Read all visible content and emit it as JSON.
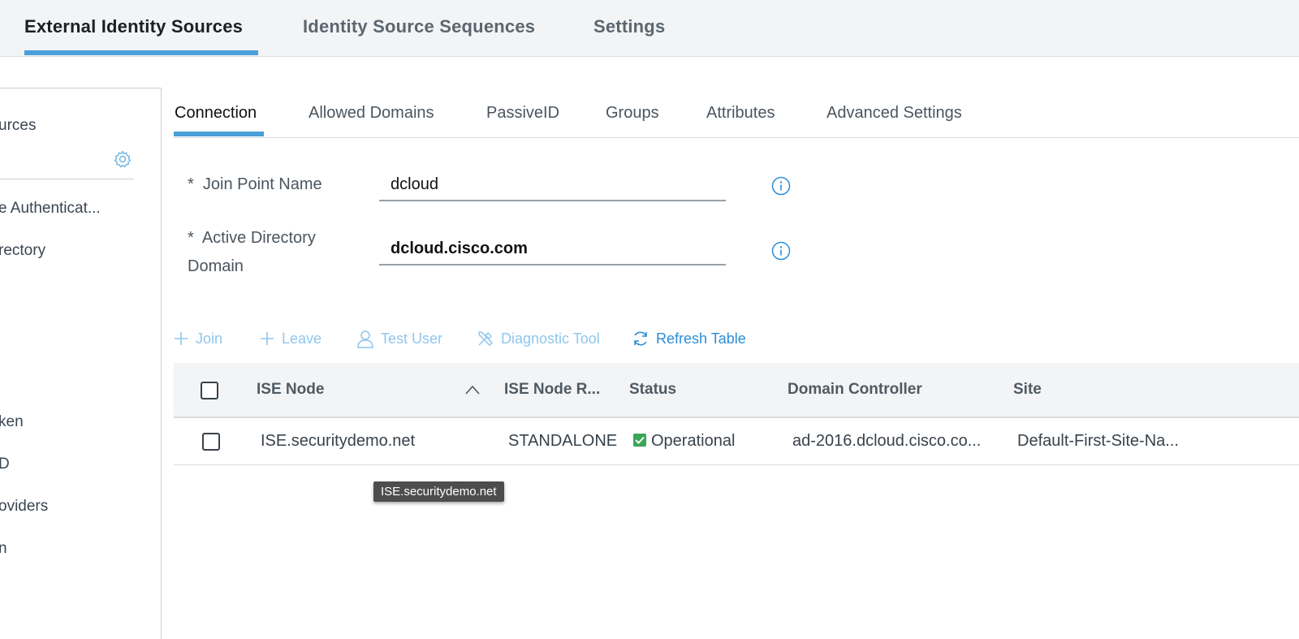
{
  "top_tabs": [
    {
      "label": "External Identity Sources",
      "active": true
    },
    {
      "label": "Identity Source Sequences",
      "active": false
    },
    {
      "label": "Settings",
      "active": false
    }
  ],
  "left_panel": {
    "items": [
      "urces",
      "e Authenticat...",
      "rectory",
      "ken",
      "D",
      "oviders",
      "n"
    ],
    "gear_icon": "gear-icon"
  },
  "sub_tabs": [
    {
      "label": "Connection",
      "active": true
    },
    {
      "label": "Allowed Domains",
      "active": false
    },
    {
      "label": "PassiveID",
      "active": false
    },
    {
      "label": "Groups",
      "active": false
    },
    {
      "label": "Attributes",
      "active": false
    },
    {
      "label": "Advanced Settings",
      "active": false
    }
  ],
  "form": {
    "join_point": {
      "required_mark": "*",
      "label": "Join Point Name",
      "value": "dcloud"
    },
    "ad_domain": {
      "required_mark": "*",
      "label_line1": "Active Directory",
      "label_line2": "Domain",
      "value": "dcloud.cisco.com"
    }
  },
  "toolbar": {
    "join": "Join",
    "leave": "Leave",
    "test_user": "Test User",
    "diagnostic_tool": "Diagnostic Tool",
    "refresh_table": "Refresh Table"
  },
  "table": {
    "columns": [
      "ISE Node",
      "ISE Node R...",
      "Status",
      "Domain Controller",
      "Site"
    ],
    "rows": [
      {
        "ise_node": "ISE.securitydemo.net",
        "role": "STANDALONE",
        "status": "Operational",
        "domain_controller": "ad-2016.dcloud.cisco.co...",
        "site": "Default-First-Site-Na..."
      }
    ]
  },
  "tooltip": "ISE.securitydemo.net",
  "colors": {
    "accent": "#4a9fd9",
    "link": "#2b8ed6",
    "link_disabled": "#8fc6ec",
    "status_ok": "#3aa657"
  }
}
